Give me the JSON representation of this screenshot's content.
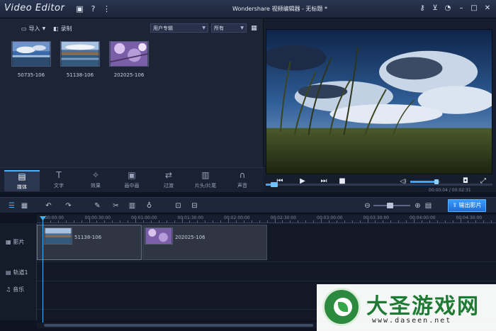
{
  "titlebar": {
    "app_name": "Video Editor",
    "window_title": "Wondershare 视频编辑器 - 无标题 *"
  },
  "media": {
    "import_label": "导入",
    "record_label": "录制",
    "album_select": "用户专辑",
    "filter_select": "所有",
    "items": [
      {
        "label": "50735-106"
      },
      {
        "label": "51138-106"
      },
      {
        "label": "202025-106"
      }
    ]
  },
  "tabs": [
    {
      "label": "媒体",
      "icon": "media-icon",
      "active": true
    },
    {
      "label": "文字",
      "icon": "text-icon",
      "active": false
    },
    {
      "label": "效果",
      "icon": "effects-icon",
      "active": false
    },
    {
      "label": "画中画",
      "icon": "pip-icon",
      "active": false
    },
    {
      "label": "过渡",
      "icon": "transition-icon",
      "active": false
    },
    {
      "label": "片头/片尾",
      "icon": "intro-credits-icon",
      "active": false
    },
    {
      "label": "声音",
      "icon": "sound-icon",
      "active": false
    }
  ],
  "preview": {
    "timecode": "00:00:04 / 00:02:31",
    "progress_fraction": 0.04,
    "volume_fraction": 0.85
  },
  "timeline": {
    "export_label": "输出影片",
    "zoom_fraction": 0.45,
    "ruler": [
      "00:00:00",
      "00:00:30:00",
      "00:01:00:00",
      "00:01:30:00",
      "00:02:00:00",
      "00:02:30:00",
      "00:03:00:00",
      "00:03:30:00",
      "00:04:00:00",
      "00:04:30:00"
    ],
    "tracks": {
      "video_label": "影片",
      "overlay_label": "轨道1",
      "music_label": "音乐"
    },
    "clips": [
      {
        "label": "51138-106"
      },
      {
        "label": "202025-106"
      }
    ]
  },
  "watermark": {
    "title": "大圣游戏网",
    "url": "www.daseen.net"
  },
  "colors": {
    "accent": "#3ba7ff",
    "background": "#0e1422",
    "brand_green": "#1f7a34"
  }
}
